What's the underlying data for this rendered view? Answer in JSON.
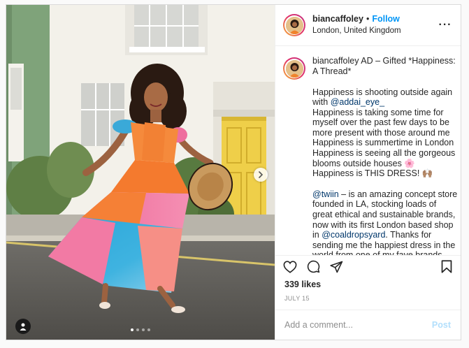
{
  "header": {
    "username": "biancaffoley",
    "bullet": "•",
    "follow_label": "Follow",
    "location": "London, United Kingdom",
    "more_label": "···"
  },
  "caption": {
    "username": "biancaffoley",
    "lines": [
      {
        "segments": [
          {
            "type": "user",
            "text": "biancaffoley"
          },
          {
            "type": "text",
            "text": " AD – Gifted *Happiness:"
          }
        ]
      },
      {
        "segments": [
          {
            "type": "text",
            "text": "A Thread*"
          }
        ]
      },
      {
        "gap": true
      },
      {
        "segments": [
          {
            "type": "text",
            "text": "Happiness is shooting outside again"
          }
        ]
      },
      {
        "segments": [
          {
            "type": "text",
            "text": "with "
          },
          {
            "type": "mention",
            "text": "@addai_eye_"
          }
        ]
      },
      {
        "segments": [
          {
            "type": "text",
            "text": "Happiness is taking some time for"
          }
        ]
      },
      {
        "segments": [
          {
            "type": "text",
            "text": "myself over the past few days to be"
          }
        ]
      },
      {
        "segments": [
          {
            "type": "text",
            "text": "more present with those around me"
          }
        ]
      },
      {
        "segments": [
          {
            "type": "text",
            "text": "Happiness is summertime in London"
          }
        ]
      },
      {
        "segments": [
          {
            "type": "text",
            "text": "Happiness is seeing all the gorgeous"
          }
        ]
      },
      {
        "segments": [
          {
            "type": "text",
            "text": "blooms outside houses 🌸"
          }
        ]
      },
      {
        "segments": [
          {
            "type": "text",
            "text": "Happiness is THIS DRESS! 🙌🏽"
          }
        ]
      },
      {
        "gap": true
      },
      {
        "segments": [
          {
            "type": "mention",
            "text": "@twiin"
          },
          {
            "type": "text",
            "text": " – is an amazing concept store"
          }
        ]
      },
      {
        "segments": [
          {
            "type": "text",
            "text": "founded in LA, stocking loads of"
          }
        ]
      },
      {
        "segments": [
          {
            "type": "text",
            "text": "great ethical and sustainable brands,"
          }
        ]
      },
      {
        "segments": [
          {
            "type": "text",
            "text": "now with its first London based shop"
          }
        ]
      },
      {
        "segments": [
          {
            "type": "text",
            "text": "in "
          },
          {
            "type": "mention",
            "text": "@coaldropsyard"
          },
          {
            "type": "text",
            "text": ". Thanks for"
          }
        ]
      },
      {
        "segments": [
          {
            "type": "text",
            "text": "sending me the happiest dress in the"
          }
        ]
      },
      {
        "segments": [
          {
            "type": "text",
            "text": "world from one of my fave brands"
          }
        ]
      }
    ]
  },
  "actions": {
    "like_icon": "heart-icon",
    "comment_icon": "comment-icon",
    "share_icon": "share-icon",
    "save_icon": "bookmark-icon"
  },
  "likes_text": "339 likes",
  "date_text": "JULY 15",
  "comment_box": {
    "placeholder": "Add a comment...",
    "post_label": "Post"
  },
  "carousel": {
    "current": 1,
    "total": 4
  },
  "colors": {
    "link_blue": "#0095f6",
    "post_disabled": "#b2dffc",
    "mention": "#00376b"
  }
}
